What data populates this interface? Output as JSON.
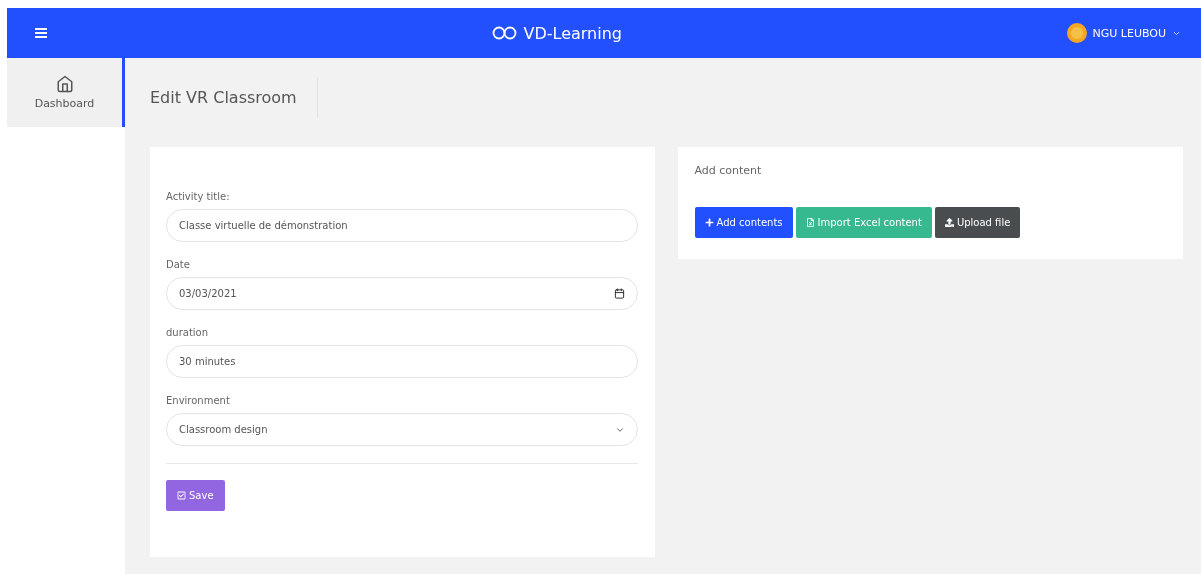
{
  "navbar": {
    "brand": "VD-Learning",
    "user": "NGU LEUBOU"
  },
  "sidebar": {
    "items": [
      {
        "label": "Dashboard",
        "selected": true
      }
    ]
  },
  "page": {
    "title": "Edit VR Classroom"
  },
  "form": {
    "fields": [
      {
        "kind": "text",
        "label": "Activity title:",
        "value": "Classe virtuelle de démonstration"
      },
      {
        "kind": "date",
        "label": "Date",
        "value": "03/03/2021"
      },
      {
        "kind": "text",
        "label": "duration",
        "value": "30 minutes"
      },
      {
        "kind": "select",
        "label": "Environment",
        "value": "Classroom design"
      }
    ],
    "save_button": "Save"
  },
  "content_panel": {
    "title": "Add content",
    "buttons": [
      {
        "kind": "primary",
        "label": "Add contents"
      },
      {
        "kind": "success",
        "label": "Import Excel content"
      },
      {
        "kind": "dark",
        "label": "Upload file"
      }
    ]
  }
}
